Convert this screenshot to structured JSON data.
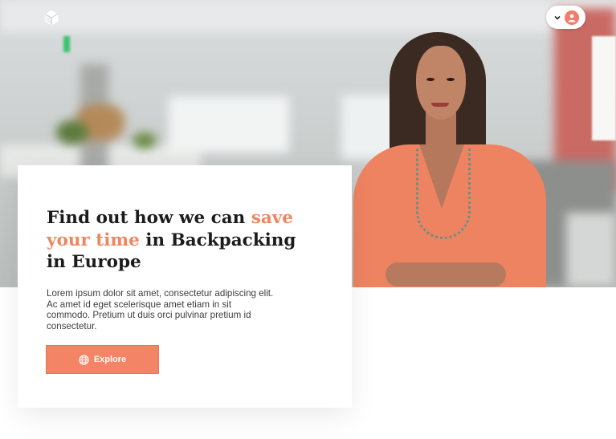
{
  "hero": {
    "image_alt": "Woman in coral sweater standing in an office"
  },
  "header": {
    "logo_icon": "cube-logo-icon",
    "user_menu": {
      "chevron_icon": "chevron-down-icon",
      "avatar_icon": "user-avatar-icon"
    }
  },
  "card": {
    "headline_part1": "Find out how we can ",
    "headline_accent": "save your time",
    "headline_part2": " in Backpacking in Europe",
    "body": "Lorem ipsum dolor sit amet, consectetur adipiscing elit. Ac amet id eget scelerisque amet etiam in sit commodo. Pretium ut duis orci pulvinar pretium id consectetur.",
    "button_label": "Explore",
    "button_icon": "globe-icon"
  },
  "colors": {
    "accent": "#f08563",
    "button": "#f48466",
    "headline": "#1c1c1c",
    "body_text": "#3d3d3d"
  }
}
